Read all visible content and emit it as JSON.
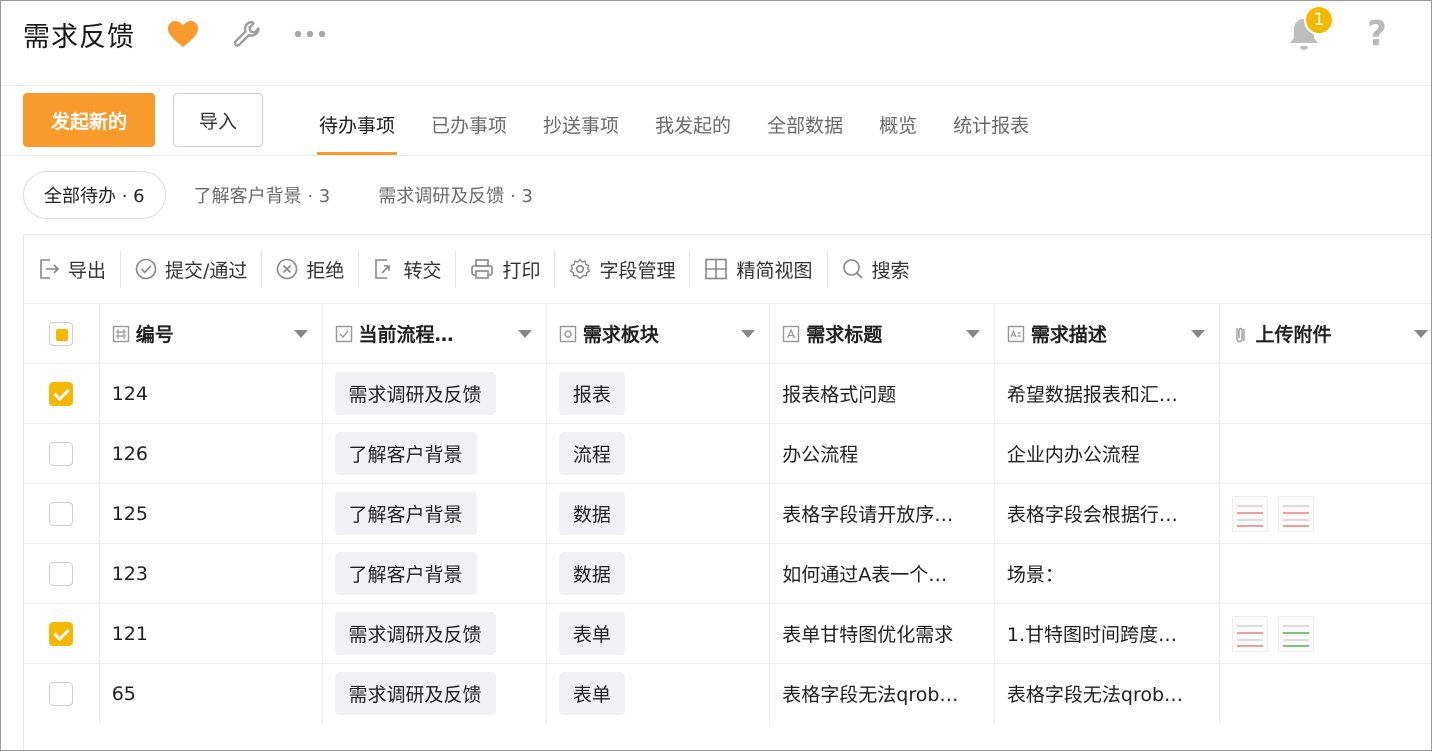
{
  "header": {
    "title": "需求反馈",
    "notification_count": "1",
    "help_symbol": "?"
  },
  "actions": {
    "create_label": "发起新的",
    "import_label": "导入"
  },
  "tabs": [
    {
      "label": "待办事项",
      "active": true
    },
    {
      "label": "已办事项",
      "active": false
    },
    {
      "label": "抄送事项",
      "active": false
    },
    {
      "label": "我发起的",
      "active": false
    },
    {
      "label": "全部数据",
      "active": false
    },
    {
      "label": "概览",
      "active": false
    },
    {
      "label": "统计报表",
      "active": false
    }
  ],
  "filters": [
    {
      "label": "全部待办 · 6",
      "active": true
    },
    {
      "label": "了解客户背景 · 3",
      "active": false
    },
    {
      "label": "需求调研及反馈 · 3",
      "active": false
    }
  ],
  "toolbar": [
    {
      "label": "导出",
      "icon": "export-icon"
    },
    {
      "label": "提交/通过",
      "icon": "check-circle-icon"
    },
    {
      "label": "拒绝",
      "icon": "reject-circle-icon"
    },
    {
      "label": "转交",
      "icon": "transfer-icon"
    },
    {
      "label": "打印",
      "icon": "printer-icon"
    },
    {
      "label": "字段管理",
      "icon": "gear-icon"
    },
    {
      "label": "精简视图",
      "icon": "grid-view-icon"
    },
    {
      "label": "搜索",
      "icon": "search-icon"
    }
  ],
  "table": {
    "columns": [
      {
        "label": "编号",
        "icon": "number-field-icon"
      },
      {
        "label": "当前流程…",
        "icon": "checkbox-field-icon"
      },
      {
        "label": "需求板块",
        "icon": "select-field-icon"
      },
      {
        "label": "需求标题",
        "icon": "text-field-icon"
      },
      {
        "label": "需求描述",
        "icon": "textarea-field-icon"
      },
      {
        "label": "上传附件",
        "icon": "attachment-field-icon"
      }
    ],
    "rows": [
      {
        "checked": true,
        "id": "124",
        "stage": "需求调研及反馈",
        "module": "报表",
        "title": "报表格式问题",
        "desc": "希望数据报表和汇…",
        "attachments": 0
      },
      {
        "checked": false,
        "id": "126",
        "stage": "了解客户背景",
        "module": "流程",
        "title": "办公流程",
        "desc": "企业内办公流程",
        "attachments": 0
      },
      {
        "checked": false,
        "id": "125",
        "stage": "了解客户背景",
        "module": "数据",
        "title": "表格字段请开放序…",
        "desc": "表格字段会根据行…",
        "attachments": 2
      },
      {
        "checked": false,
        "id": "123",
        "stage": "了解客户背景",
        "module": "数据",
        "title": "如何通过A表一个…",
        "desc": "场景：",
        "attachments": 0
      },
      {
        "checked": true,
        "id": "121",
        "stage": "需求调研及反馈",
        "module": "表单",
        "title": "表单甘特图优化需求",
        "desc": "1.甘特图时间跨度…",
        "attachments": 2
      },
      {
        "checked": false,
        "id": "65",
        "stage": "需求调研及反馈",
        "module": "表单",
        "title": "表格字段无法qrob…",
        "desc": "表格字段无法qrob…",
        "attachments": 0
      }
    ]
  },
  "colors": {
    "accent": "#f89a2c",
    "check": "#f5b800",
    "tag_bg": "#f2f2f4"
  }
}
